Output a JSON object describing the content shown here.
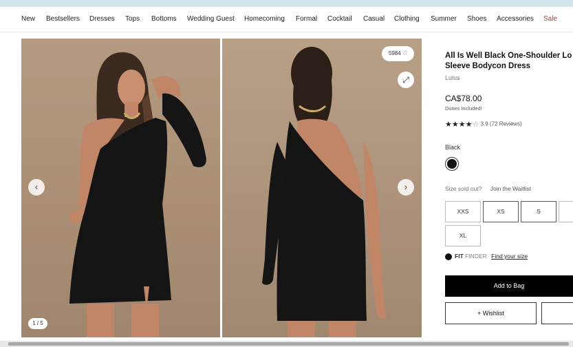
{
  "nav": {
    "items": [
      "New",
      "Bestsellers",
      "Dresses",
      "Tops",
      "Bottoms",
      "Wedding Guest",
      "Homecoming",
      "Formal",
      "Cocktail",
      "Casual",
      "Clothing",
      "Summer",
      "Shoes",
      "Accessories",
      "Sale"
    ]
  },
  "gallery": {
    "likes": "5984 ♡",
    "counter": "1 / 5",
    "prev_icon": "‹",
    "next_icon": "›",
    "expand_icon": "⤢"
  },
  "product": {
    "title_line1": "All Is Well Black One-Shoulder Lo",
    "title_line2": "Sleeve Bodycon Dress",
    "brand": "Lulus",
    "price": "CA$78.00",
    "duties": "Duties Included!",
    "rating_value": "3.9",
    "reviews": "(72 Reviews)",
    "color_label": "Black",
    "size_sold_out": "Size sold out?",
    "join_waitlist": "Join the Waitlist",
    "sizes": [
      {
        "label": "XXS",
        "available": false
      },
      {
        "label": "XS",
        "available": true
      },
      {
        "label": "S",
        "available": true
      },
      {
        "label": "XL",
        "available": false
      }
    ],
    "fit_brand": "FIT",
    "fit_finder": "FINDER",
    "find_size": "Find your size",
    "add_to_bag": "Add to Bag",
    "wishlist": "+ Wishlist"
  },
  "colors": {
    "accent_black": "#000000",
    "sale_red": "#c0392b",
    "photo_bg": "#ab917a"
  }
}
